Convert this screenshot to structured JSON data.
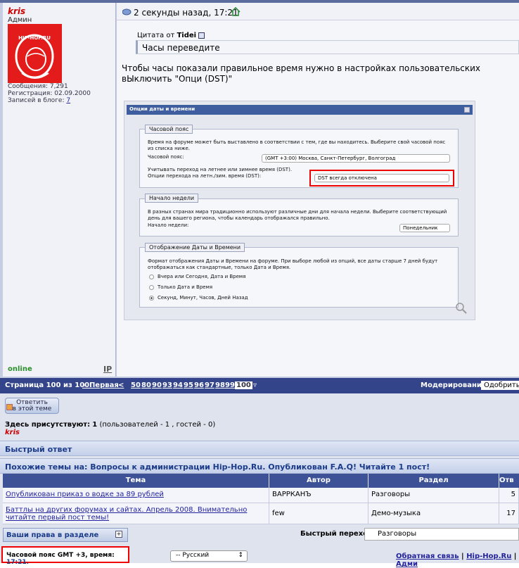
{
  "post": {
    "username": "kris",
    "role": "Админ",
    "avatar_text": "HIP-HOP.RU",
    "stats": [
      {
        "label": "Сообщения:",
        "value": "7,291"
      },
      {
        "label": "Регистрация:",
        "value": "02.09.2000"
      },
      {
        "label": "Записей в блоге:",
        "value": "7"
      }
    ],
    "status": "online",
    "ip_label": "IP",
    "time": "2 секунды назад, 17:21",
    "quote_author_prefix": "Цитата от",
    "quote_author": "Tidei",
    "quote_text": "Часы переведите",
    "text": "Чтобы часы показали правильное время нужно в настройках пользовательских вЫключить \"Опци (DST)\""
  },
  "screenshot": {
    "title": "Опции даты и времени",
    "timezone": {
      "legend": "Часовой пояс",
      "desc": "Время на форуме может быть выставлено в соответствии с тем, где вы находитесь. Выберите свой часовой пояс из списка ниже.",
      "label": "Часовой пояс:",
      "value": "(GMT +3:00) Москва, Санкт-Петербург, Волгоград",
      "dst_desc": "Учитывать переход на летнее или зимнее время (DST).",
      "dst_label": "Опции перехода на летн./зим. время (DST):",
      "dst_value": "DST всегда отключена"
    },
    "week": {
      "legend": "Начало недели",
      "desc": "В разных странах мира традиционно используют различные дни для начала недели. Выберите соответствующий день для вашего региона, чтобы календарь отображался правильно.",
      "label": "Начало недели:",
      "value": "Понедельник"
    },
    "display": {
      "legend": "Отображение Даты и Времени",
      "desc": "Формат отображения Даты и Времени на форуме. При выборе любой из опций, все даты старше 7 дней будут отображаться как стандартные, только Дата и Время.",
      "options": [
        "Вчера или Сегодня, Дата и Время",
        "Только Дата и Время",
        "Секунд, Минут, Часов, Дней Назад"
      ]
    }
  },
  "navbar": {
    "page_info": "Страница 100 из 100:",
    "first": "« Первая",
    "prev": "<",
    "pages": [
      "50",
      "80",
      "90",
      "93",
      "94",
      "95",
      "96",
      "97",
      "98",
      "99"
    ],
    "current": "100",
    "moderation_label": "Модерирование:",
    "moderation_value": "Одобрить"
  },
  "reply_button": [
    "Ответить",
    "в этой теме"
  ],
  "present": {
    "label": "Здесь присутствуют:",
    "count": "1",
    "detail": "(пользователей - 1 , гостей - 0)",
    "user": "kris"
  },
  "quick_reply": "Быстрый ответ",
  "similar": {
    "title": "Похожие темы на: Вопросы к администрации Hip-Hop.Ru. Опубликован F.A.Q! Читайте 1 пост!",
    "headers": [
      "Тема",
      "Автор",
      "Раздел",
      "Отв"
    ],
    "rows": [
      {
        "topic": "Опубликован приказ о водке за 89 рублей",
        "author": "ВАРРКАНЪ",
        "section": "Разговоры",
        "replies": "5"
      },
      {
        "topic": "Баттлы на других форумах и сайтах. Апрель 2008. Внимательно читайте первый пост темы!",
        "author": "few",
        "section": "Демо-музыка",
        "replies": "17"
      }
    ]
  },
  "rights": "Ваши права в разделе",
  "quick_nav": {
    "label": "Быстрый переход",
    "value": "Разговоры"
  },
  "footer": {
    "tz_text": "Часовой пояс GMT +3, время:",
    "tz_time": "17:21.",
    "language": "-- Русский",
    "links": [
      "Обратная связь",
      "Hip-Hop.Ru",
      "Адми"
    ]
  },
  "colors": {
    "navbar": "#33448a",
    "accent_red": "#e00000",
    "link": "#22229c"
  }
}
